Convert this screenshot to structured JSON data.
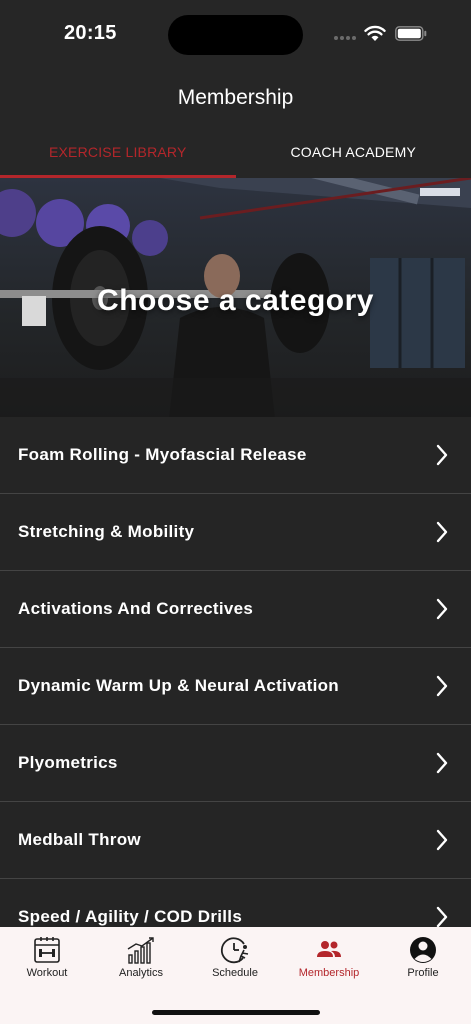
{
  "status_bar": {
    "time": "20:15"
  },
  "header": {
    "title": "Membership"
  },
  "tabs": [
    {
      "label": "EXERCISE LIBRARY",
      "active": true
    },
    {
      "label": "COACH ACADEMY",
      "active": false
    }
  ],
  "hero": {
    "title": "Choose a category"
  },
  "categories": [
    {
      "label": "Foam Rolling - Myofascial Release"
    },
    {
      "label": "Stretching & Mobility"
    },
    {
      "label": "Activations And Correctives"
    },
    {
      "label": "Dynamic Warm Up & Neural Activation"
    },
    {
      "label": "Plyometrics"
    },
    {
      "label": "Medball Throw"
    },
    {
      "label": "Speed / Agility / COD Drills"
    }
  ],
  "bottom_nav": [
    {
      "label": "Workout",
      "icon": "calendar-dumbbell-icon"
    },
    {
      "label": "Analytics",
      "icon": "bar-chart-icon"
    },
    {
      "label": "Schedule",
      "icon": "clock-runner-icon"
    },
    {
      "label": "Membership",
      "icon": "group-icon",
      "active": true
    },
    {
      "label": "Profile",
      "icon": "profile-icon"
    }
  ],
  "colors": {
    "accent": "#b3262b",
    "background": "#252525",
    "nav_background": "#fbf4f4"
  }
}
